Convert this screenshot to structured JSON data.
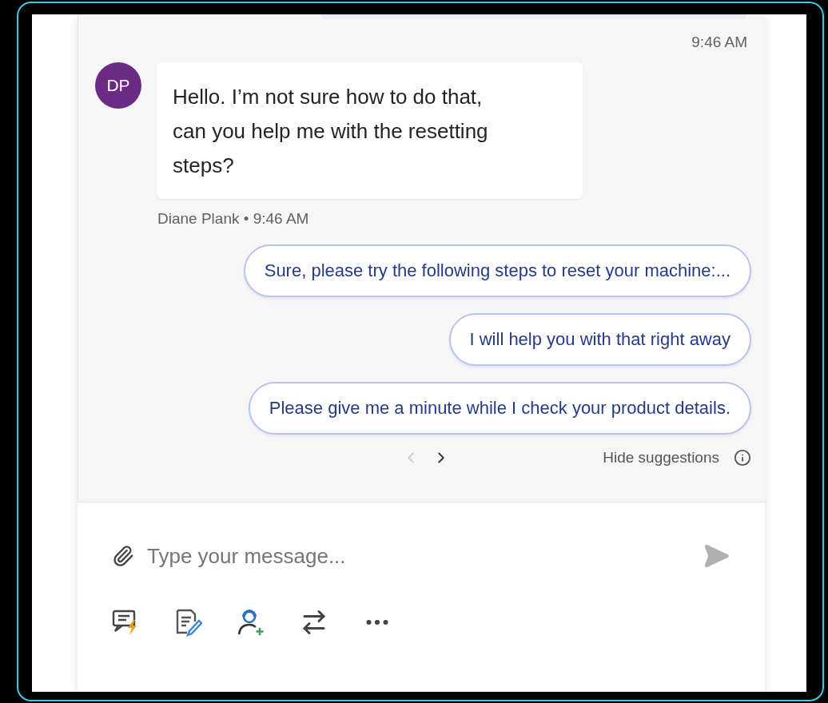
{
  "chat": {
    "top_timestamp": "9:46 AM",
    "message": {
      "initials": "DP",
      "text": "Hello. I’m not sure how to do that, can you help me with the resetting steps?",
      "sender": "Diane Plank",
      "separator": "•",
      "time": "9:46 AM"
    },
    "suggestions": [
      {
        "text": "Sure, please try the following steps to reset your machine:..."
      },
      {
        "text": "I will help you with that right away"
      },
      {
        "text": "Please give me a minute while I check your product details."
      }
    ],
    "pager": {
      "prev_disabled": true,
      "next_disabled": false
    },
    "hide_suggestions": "Hide suggestions"
  },
  "composer": {
    "placeholder": "Type your message..."
  }
}
